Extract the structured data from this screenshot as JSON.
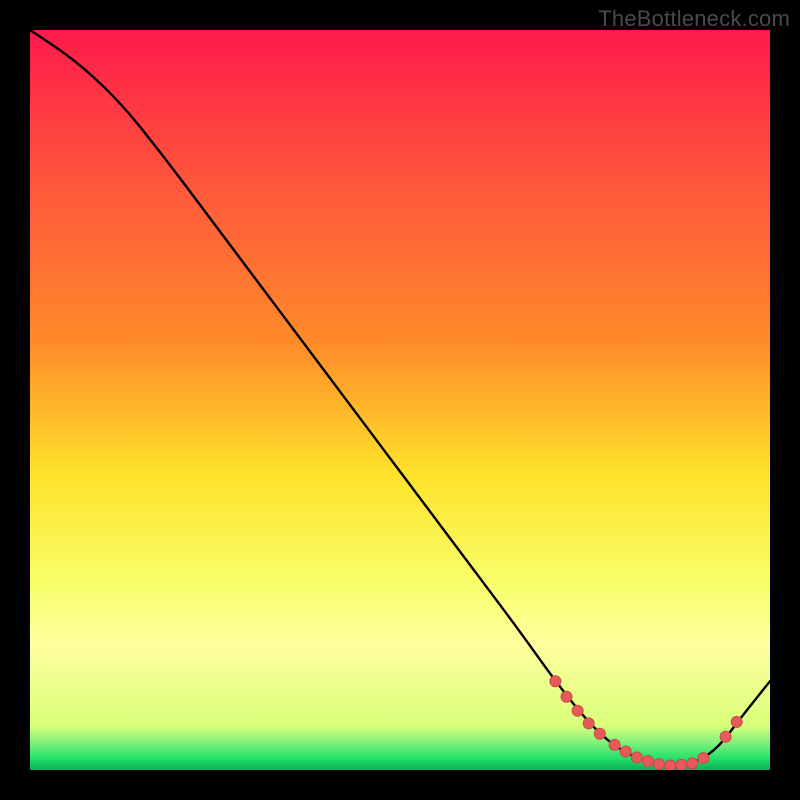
{
  "attribution": "TheBottleneck.com",
  "colors": {
    "background": "#000000",
    "gradient_top": "#ff1a4b",
    "gradient_upper_mid": "#ff8a2a",
    "gradient_mid": "#ffe22a",
    "gradient_lower_mid": "#f8ff6a",
    "gradient_band": "#ffff9e",
    "gradient_green": "#1fe06a",
    "curve": "#000000",
    "marker_fill": "#e65a5a",
    "marker_stroke": "#c94b4b"
  },
  "chart_data": {
    "type": "line",
    "title": "",
    "xlabel": "",
    "ylabel": "",
    "xlim": [
      0,
      100
    ],
    "ylim": [
      0,
      100
    ],
    "series": [
      {
        "name": "bottleneck-curve",
        "x": [
          0,
          6,
          12,
          18,
          24,
          30,
          36,
          42,
          48,
          54,
          60,
          66,
          71,
          75,
          78,
          81,
          84,
          87,
          90,
          93,
          96,
          100
        ],
        "y": [
          100,
          96,
          90.5,
          83,
          75,
          67,
          59,
          51,
          43,
          35,
          27,
          19,
          12,
          7,
          4,
          2,
          1,
          0.6,
          1,
          3,
          7,
          12
        ]
      }
    ],
    "markers": [
      {
        "x": 71.0,
        "y": 12.0
      },
      {
        "x": 72.5,
        "y": 9.9
      },
      {
        "x": 74.0,
        "y": 8.0
      },
      {
        "x": 75.5,
        "y": 6.3
      },
      {
        "x": 77.0,
        "y": 4.9
      },
      {
        "x": 79.0,
        "y": 3.4
      },
      {
        "x": 80.5,
        "y": 2.5
      },
      {
        "x": 82.0,
        "y": 1.7
      },
      {
        "x": 83.5,
        "y": 1.2
      },
      {
        "x": 85.0,
        "y": 0.8
      },
      {
        "x": 86.5,
        "y": 0.6
      },
      {
        "x": 88.0,
        "y": 0.7
      },
      {
        "x": 89.5,
        "y": 0.9
      },
      {
        "x": 91.0,
        "y": 1.6
      },
      {
        "x": 94.0,
        "y": 4.5
      },
      {
        "x": 95.5,
        "y": 6.5
      }
    ],
    "gradient_band_y": 80,
    "green_band_y": 96
  }
}
